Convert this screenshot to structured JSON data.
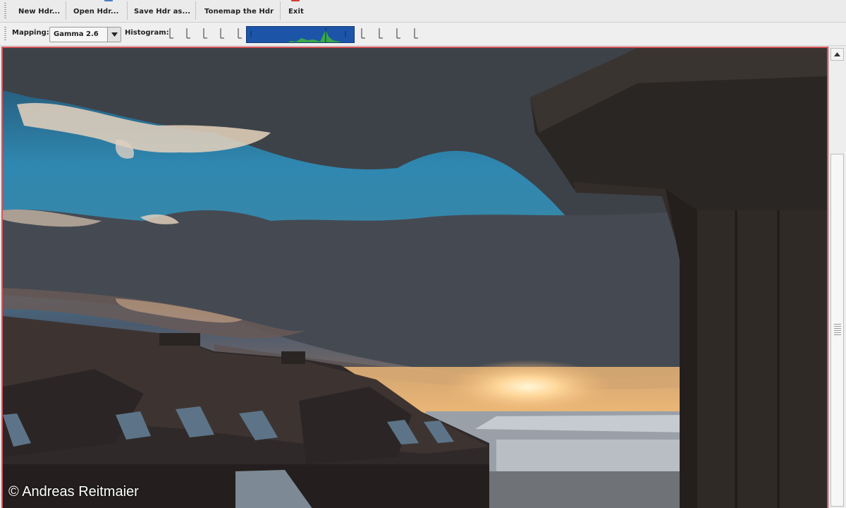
{
  "toolbar": {
    "new_label": "New Hdr...",
    "open_label": "Open Hdr...",
    "save_label": "Save Hdr as...",
    "tonemap_label": "Tonemap the Hdr",
    "exit_label": "Exit"
  },
  "options_bar": {
    "mapping_label": "Mapping:",
    "mapping_value": "Gamma 2.6",
    "histogram_label": "Histogram:"
  },
  "colors": {
    "viewport_border": "#d8545a",
    "histogram_bg": "#1c55a8",
    "histogram_curve": "#3aa84a"
  },
  "credit": "© Andreas Reitmaier"
}
